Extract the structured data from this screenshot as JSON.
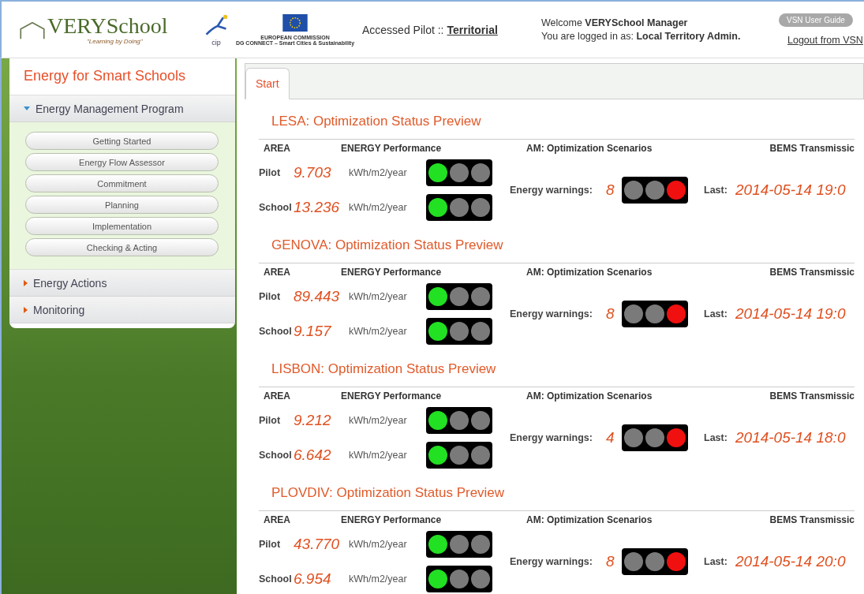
{
  "header": {
    "logo": {
      "name": "VERYSchool",
      "tagline": "\"Learning by Doing\""
    },
    "cip_logo": "cip",
    "ec_logo": {
      "line1": "EUROPEAN COMMISSION",
      "line2": "DG CONNECT – Smart Cities & Sustainability"
    },
    "pilot": {
      "label": "Accessed Pilot ::",
      "value": "Territorial"
    },
    "welcome": {
      "prefix": "Welcome",
      "user": "VERYSchool Manager"
    },
    "login": {
      "prefix": "You are logged in as:",
      "role": "Local Territory Admin."
    },
    "guide_button": "VSN User Guide",
    "logout_link": "Logout from VSN"
  },
  "sidebar": {
    "title": "Energy for Smart Schools",
    "sections": [
      {
        "label": "Energy Management Program",
        "expanded": true,
        "items": [
          "Getting Started",
          "Energy Flow Assessor",
          "Commitment",
          "Planning",
          "Implementation",
          "Checking & Acting"
        ]
      },
      {
        "label": "Energy Actions",
        "expanded": false
      },
      {
        "label": "Monitoring",
        "expanded": false
      }
    ]
  },
  "tabs": [
    {
      "label": "Start",
      "selected": true
    }
  ],
  "panels": [
    {
      "title": "LESA: Optimization Status Preview",
      "columns": [
        "AREA",
        "ENERGY Performance",
        "AM: Optimization Scenarios",
        "BEMS Transmissic"
      ],
      "rows": [
        {
          "area": "Pilot",
          "value": "9.703",
          "unit": "kWh/m2/year",
          "lamps": [
            {
              "on": true
            },
            {
              "on": false
            },
            {
              "on": false
            }
          ]
        },
        {
          "area": "School",
          "value": "13.236",
          "unit": "kWh/m2/year",
          "lamps": [
            {
              "on": true
            },
            {
              "on": false
            },
            {
              "on": false
            }
          ]
        }
      ],
      "warnings": {
        "label": "Energy warnings:",
        "value": "8",
        "lamps": [
          {
            "on": false
          },
          {
            "on": false
          },
          {
            "on": true
          }
        ]
      },
      "last": {
        "label": "Last:",
        "value": "2014-05-14 19:0"
      }
    },
    {
      "title": "GENOVA: Optimization Status Preview",
      "columns": [
        "AREA",
        "ENERGY Performance",
        "AM: Optimization Scenarios",
        "BEMS Transmissic"
      ],
      "rows": [
        {
          "area": "Pilot",
          "value": "89.443",
          "unit": "kWh/m2/year",
          "lamps": [
            {
              "on": true
            },
            {
              "on": false
            },
            {
              "on": false
            }
          ]
        },
        {
          "area": "School",
          "value": "9.157",
          "unit": "kWh/m2/year",
          "lamps": [
            {
              "on": true
            },
            {
              "on": false
            },
            {
              "on": false
            }
          ]
        }
      ],
      "warnings": {
        "label": "Energy warnings:",
        "value": "8",
        "lamps": [
          {
            "on": false
          },
          {
            "on": false
          },
          {
            "on": true
          }
        ]
      },
      "last": {
        "label": "Last:",
        "value": "2014-05-14 19:0"
      }
    },
    {
      "title": "LISBON: Optimization Status Preview",
      "columns": [
        "AREA",
        "ENERGY Performance",
        "AM: Optimization Scenarios",
        "BEMS Transmissic"
      ],
      "rows": [
        {
          "area": "Pilot",
          "value": "9.212",
          "unit": "kWh/m2/year",
          "lamps": [
            {
              "on": true
            },
            {
              "on": false
            },
            {
              "on": false
            }
          ]
        },
        {
          "area": "School",
          "value": "6.642",
          "unit": "kWh/m2/year",
          "lamps": [
            {
              "on": true
            },
            {
              "on": false
            },
            {
              "on": false
            }
          ]
        }
      ],
      "warnings": {
        "label": "Energy warnings:",
        "value": "4",
        "lamps": [
          {
            "on": false
          },
          {
            "on": false
          },
          {
            "on": true
          }
        ]
      },
      "last": {
        "label": "Last:",
        "value": "2014-05-14 18:0"
      }
    },
    {
      "title": "PLOVDIV: Optimization Status Preview",
      "columns": [
        "AREA",
        "ENERGY Performance",
        "AM: Optimization Scenarios",
        "BEMS Transmissic"
      ],
      "rows": [
        {
          "area": "Pilot",
          "value": "43.770",
          "unit": "kWh/m2/year",
          "lamps": [
            {
              "on": true
            },
            {
              "on": false
            },
            {
              "on": false
            }
          ]
        },
        {
          "area": "School",
          "value": "6.954",
          "unit": "kWh/m2/year",
          "lamps": [
            {
              "on": true
            },
            {
              "on": false
            },
            {
              "on": false
            }
          ]
        }
      ],
      "warnings": {
        "label": "Energy warnings:",
        "value": "8",
        "lamps": [
          {
            "on": false
          },
          {
            "on": false
          },
          {
            "on": true
          }
        ]
      },
      "last": {
        "label": "Last:",
        "value": "2014-05-14 20:0"
      }
    }
  ]
}
